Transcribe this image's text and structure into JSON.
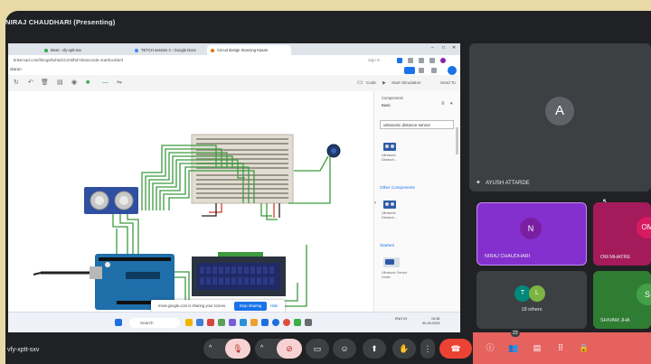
{
  "presenter_title": "NIRAJ CHAUDHARI (Presenting)",
  "browser": {
    "tabs": [
      {
        "label": "Meet - vfy-xptt-sxv",
        "color": "#34a853"
      },
      {
        "label": "TETCH session 2 - Google Docs",
        "color": "#4285f4"
      },
      {
        "label": "Circuit design Stunning Kasan",
        "color": "#e37400"
      }
    ],
    "url": "tinkercad.com/things/bxh6cbCZ4dhd?sharecode=Ka0l1xdxkrd",
    "signin": "Sign in"
  },
  "tinkercad": {
    "brand": "diaran",
    "code_label": "Code",
    "start_sim_label": "Start Simulation",
    "send_to_label": "Send To",
    "components_label": "Components",
    "basic_label": "Basic",
    "search_value": "ultrasonic distance sensor",
    "result1_caption": "Ultrasonic Distance...",
    "other_components": "Other Components",
    "result2_caption": "Ultrasonic Distance...",
    "starters": "Starters",
    "starter_caption": "Ultrasonic Sensor Under",
    "lcd_text": "",
    "arduino_label": "UNO"
  },
  "share_notice": {
    "message": "meet.google.com is sharing your screen.",
    "stop": "Stop sharing",
    "hide": "Hide"
  },
  "taskbar": {
    "search": "Search",
    "lang": "ENG IN",
    "time": "15:38",
    "date": "30-09-2023"
  },
  "participants": {
    "main": {
      "initial": "A",
      "name": "AYUSH ATTARDE",
      "bg": "#3c4043",
      "avatar": "#5f6368"
    },
    "niraj": {
      "initial": "N",
      "name": "NIRAJ CHAUDHARI",
      "bg": "#8430ce",
      "avatar": "#7b1fa2"
    },
    "om": {
      "initial": "OM",
      "name": "OM MHATRE",
      "bg": "#a51a5a",
      "avatar": "#d81b60"
    },
    "others": {
      "initial1": "T",
      "initial2": "L",
      "label": "18 others",
      "bg": "#3c4043"
    },
    "shivam": {
      "initial": "S",
      "name": "SHIVAM JHA",
      "bg": "#2e7d32",
      "avatar": "#43a047"
    }
  },
  "meeting": {
    "code": "vfy-xptt-sxv",
    "participant_count": "23",
    "colors": {
      "mic_off_bg": "#f6d3d2",
      "end_call": "#ea4335",
      "panel": "#e5625f"
    }
  },
  "icons": [
    "pin-icon",
    "mic-off-icon",
    "camera-off-icon",
    "captions-icon",
    "emoji-icon",
    "present-icon",
    "raise-hand-icon",
    "more-icon",
    "end-call-icon",
    "info-icon",
    "people-icon",
    "chat-icon",
    "activities-icon",
    "host-controls-icon"
  ]
}
